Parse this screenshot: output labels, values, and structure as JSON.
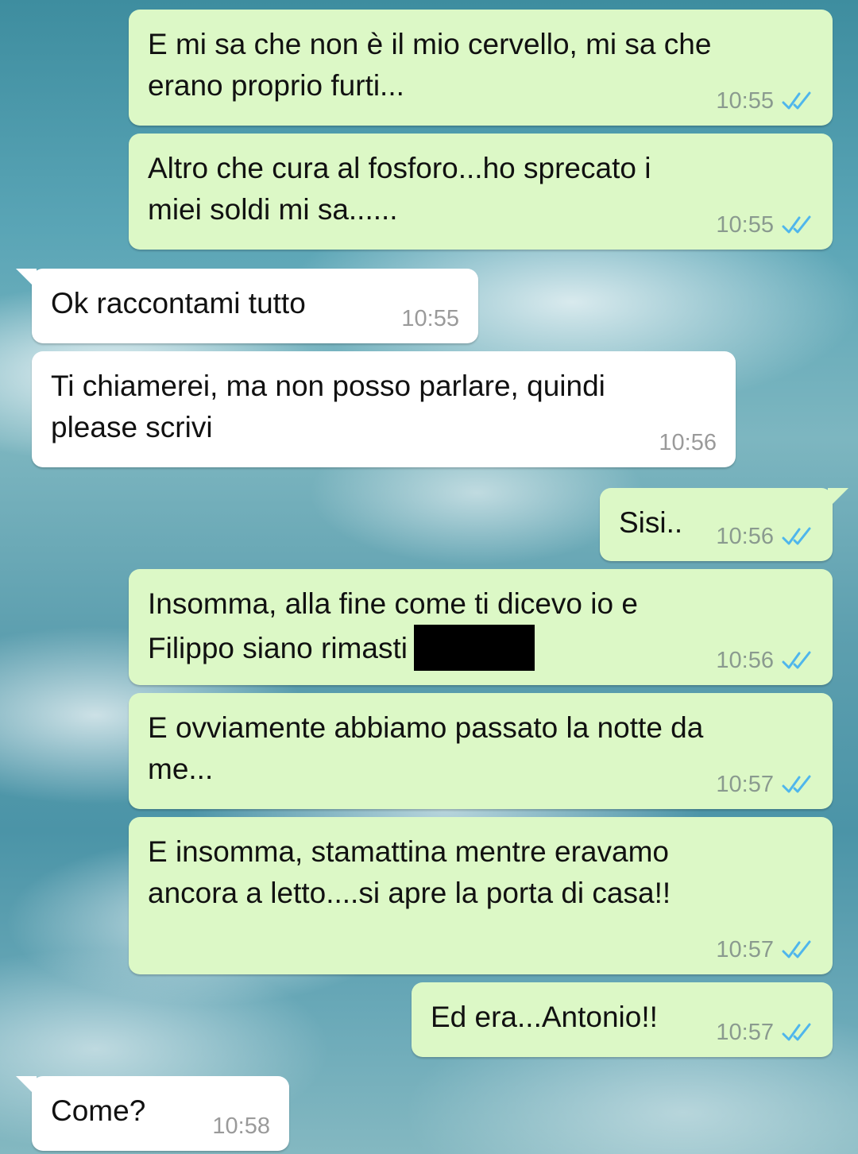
{
  "messages": [
    {
      "text": "E mi sa che non è il mio cervello, mi sa che\nerano proprio furti...",
      "time": "10:55",
      "direction": "out"
    },
    {
      "text": "Altro che cura al fosforo...ho sprecato i\nmiei soldi mi sa......",
      "time": "10:55",
      "direction": "out"
    },
    {
      "text": "Ok raccontami tutto",
      "time": "10:55",
      "direction": "in"
    },
    {
      "text": "Ti chiamerei, ma non posso parlare, quindi\nplease scrivi",
      "time": "10:56",
      "direction": "in"
    },
    {
      "text": "Sisi..",
      "time": "10:56",
      "direction": "out"
    },
    {
      "text": "Insomma, alla fine come ti dicevo io e\nFilippo siano rimasti",
      "time": "10:56",
      "direction": "out",
      "redacted": true
    },
    {
      "text": "E ovviamente abbiamo passato la notte da\nme...",
      "time": "10:57",
      "direction": "out"
    },
    {
      "text": "E insomma, stamattina mentre eravamo\nancora a letto....si apre la porta di casa!!",
      "time": "10:57",
      "direction": "out"
    },
    {
      "text": "Ed era...Antonio!!",
      "time": "10:57",
      "direction": "out"
    },
    {
      "text": "Come?",
      "time": "10:58",
      "direction": "in"
    }
  ],
  "colors": {
    "outgoing_bubble": "#dcf8c6",
    "incoming_bubble": "#ffffff",
    "read_ticks": "#4fb6ec"
  },
  "icons": {
    "read_receipt": "double-check-icon"
  }
}
